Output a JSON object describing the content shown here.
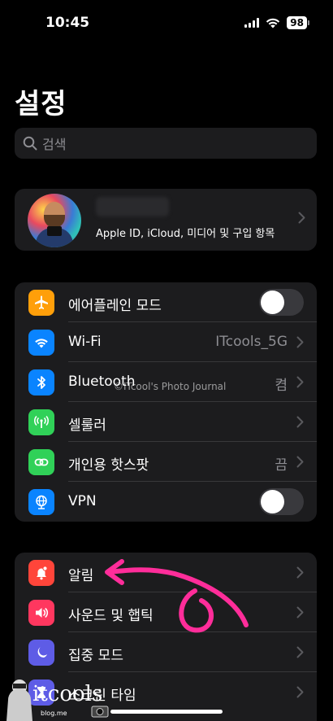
{
  "status_bar": {
    "time": "10:45",
    "battery": "98"
  },
  "page_title": "설정",
  "search": {
    "placeholder": "검색"
  },
  "profile": {
    "subtitle": "Apple ID, iCloud, 미디어 및 구입 항목"
  },
  "group1": [
    {
      "label": "에어플레인 모드",
      "icon": "airplane-icon",
      "color": "#ff9f0a",
      "toggle": false
    },
    {
      "label": "Wi-Fi",
      "icon": "wifi-icon",
      "color": "#0a84ff",
      "value": "ITcools_5G"
    },
    {
      "label": "Bluetooth",
      "icon": "bluetooth-icon",
      "color": "#0a84ff",
      "value": "켬"
    },
    {
      "label": "셀룰러",
      "icon": "cellular-icon",
      "color": "#30d158"
    },
    {
      "label": "개인용 핫스팟",
      "icon": "hotspot-icon",
      "color": "#30d158",
      "value": "끔"
    },
    {
      "label": "VPN",
      "icon": "vpn-icon",
      "color": "#0a84ff",
      "toggle": false
    }
  ],
  "group2": [
    {
      "label": "알림",
      "icon": "notification-icon",
      "color": "#ff453a"
    },
    {
      "label": "사운드 및 햅틱",
      "icon": "sound-icon",
      "color": "#ff375f"
    },
    {
      "label": "집중 모드",
      "icon": "moon-icon",
      "color": "#5e5ce6"
    },
    {
      "label": "스크린 타임",
      "icon": "hourglass-icon",
      "color": "#5e5ce6"
    }
  ],
  "watermark": "©ITcool's Photo Journal",
  "logo": {
    "text": "itcools",
    "sub": "blog.me"
  }
}
